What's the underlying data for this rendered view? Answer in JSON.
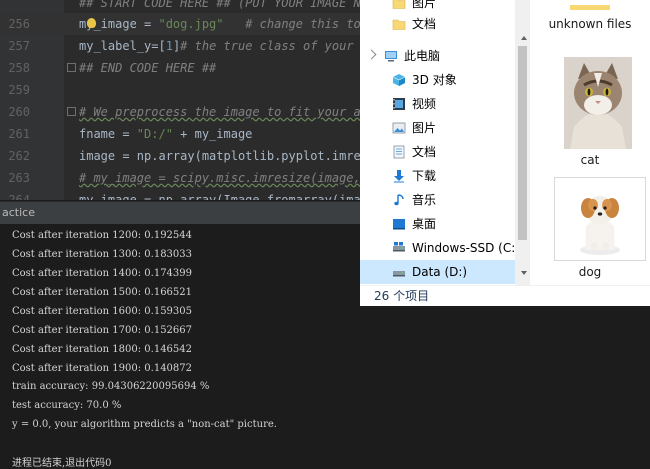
{
  "editor": {
    "lines": [
      {
        "num": "",
        "parts": [
          {
            "c": "cmt",
            "t": "## START CODE HERE ## (PUT YOUR IMAGE NA"
          }
        ]
      },
      {
        "num": "256",
        "parts": [
          {
            "c": "",
            "t": "my_image = "
          },
          {
            "c": "str",
            "t": "\"dog.jpg\""
          },
          {
            "c": "cmt",
            "t": "   # change this to"
          }
        ]
      },
      {
        "num": "257",
        "parts": [
          {
            "c": "",
            "t": "my_label_y=["
          },
          {
            "c": "num",
            "t": "1"
          },
          {
            "c": "",
            "t": "]"
          },
          {
            "c": "cmt",
            "t": "# the true class of your i"
          }
        ]
      },
      {
        "num": "258",
        "parts": [
          {
            "c": "cmt",
            "t": "## END CODE HERE ##"
          }
        ]
      },
      {
        "num": "259",
        "parts": []
      },
      {
        "num": "260",
        "parts": [
          {
            "c": "cmt",
            "t": "# We preprocess the image to fit your al"
          }
        ]
      },
      {
        "num": "261",
        "parts": [
          {
            "c": "",
            "t": "fname = "
          },
          {
            "c": "str",
            "t": "\"D:/\""
          },
          {
            "c": "",
            "t": " + my_image"
          }
        ]
      },
      {
        "num": "262",
        "parts": [
          {
            "c": "",
            "t": "image = np.array(matplotlib.pyplot.imrea"
          }
        ]
      },
      {
        "num": "263",
        "parts": [
          {
            "c": "cmt",
            "t": "# my_image = scipy.misc.imresize(image,"
          }
        ]
      },
      {
        "num": "264",
        "parts": [
          {
            "c": "",
            "t": "my_image = np.array(Image.fromarray(imag"
          }
        ]
      }
    ]
  },
  "run_panel": {
    "title": "actice",
    "output": [
      "Cost after iteration 1200: 0.192544",
      "Cost after iteration 1300: 0.183033",
      "Cost after iteration 1400: 0.174399",
      "Cost after iteration 1500: 0.166521",
      "Cost after iteration 1600: 0.159305",
      "Cost after iteration 1700: 0.152667",
      "Cost after iteration 1800: 0.146542",
      "Cost after iteration 1900: 0.140872",
      "train accuracy: 99.04306220095694 %",
      "test accuracy: 70.0 %",
      "y = 0.0, your algorithm predicts a \"non-cat\" picture.",
      "",
      "进程已结束,退出代码0"
    ]
  },
  "explorer": {
    "nav_items": [
      {
        "label": "图片",
        "icon": "folder-icon"
      },
      {
        "label": "文档",
        "icon": "folder-icon"
      },
      {
        "label": "此电脑",
        "icon": "computer-icon"
      },
      {
        "label": "3D 对象",
        "icon": "cube-icon"
      },
      {
        "label": "视频",
        "icon": "video-icon"
      },
      {
        "label": "图片",
        "icon": "pictures-icon"
      },
      {
        "label": "文档",
        "icon": "documents-icon"
      },
      {
        "label": "下载",
        "icon": "download-icon"
      },
      {
        "label": "音乐",
        "icon": "music-icon"
      },
      {
        "label": "桌面",
        "icon": "desktop-icon"
      },
      {
        "label": "Windows-SSD (C:",
        "icon": "drive-icon"
      },
      {
        "label": "Data (D:)",
        "icon": "drive-icon"
      }
    ],
    "files": [
      {
        "name": "unknown files"
      },
      {
        "name": "cat"
      },
      {
        "name": "dog"
      }
    ],
    "status": "26 个项目"
  }
}
